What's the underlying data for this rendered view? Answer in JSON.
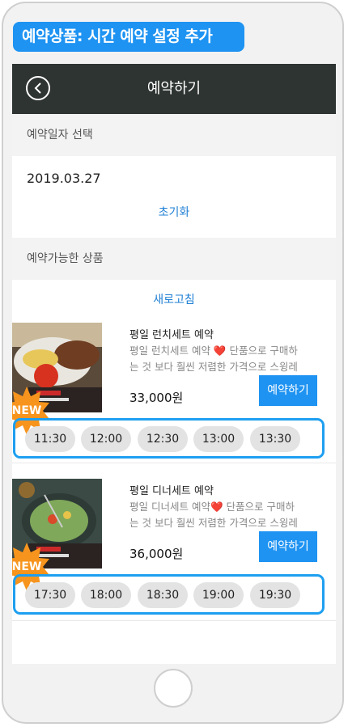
{
  "banner": "예약상품: 시간 예약 설정 추가",
  "header": {
    "title": "예약하기"
  },
  "date_section": {
    "label": "예약일자 선택",
    "value": "2019.03.27",
    "reset_label": "초기화"
  },
  "products_section": {
    "label": "예약가능한 상품",
    "refresh_label": "새로고침"
  },
  "products": [
    {
      "title": "평일 런치세트 예약",
      "desc_line1": "평일 런치세트 예약 ❤️ 단품으로 구매하",
      "desc_line2": "는 것 보다 훨씬 저렴한 가격으로 스윙레",
      "price": "33,000원",
      "button": "예약하기",
      "badge": "NEW",
      "slots": [
        "11:30",
        "12:00",
        "12:30",
        "13:00",
        "13:30"
      ]
    },
    {
      "title": "평일 디너세트 예약",
      "desc_line1": "평일 디너세트 예약❤️ 단품으로 구매하",
      "desc_line2": "는 것 보다 훨씬 저렴한 가격으로 스윙레",
      "price": "36,000원",
      "button": "예약하기",
      "badge": "NEW",
      "slots": [
        "17:30",
        "18:00",
        "18:30",
        "19:00",
        "19:30"
      ]
    }
  ]
}
